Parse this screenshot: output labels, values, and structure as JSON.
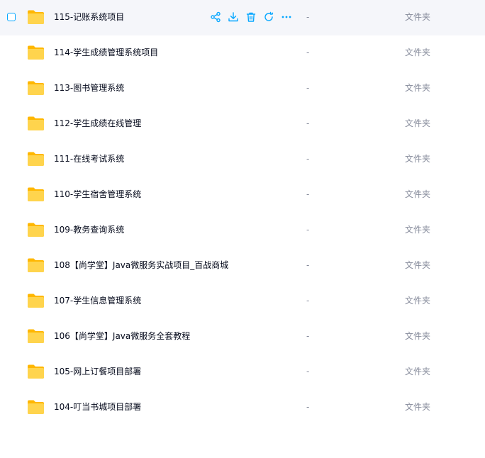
{
  "files": [
    {
      "name": "115-记账系统项目",
      "size": "-",
      "type": "文件夹"
    },
    {
      "name": "114-学生成绩管理系统项目",
      "size": "-",
      "type": "文件夹"
    },
    {
      "name": "113-图书管理系统",
      "size": "-",
      "type": "文件夹"
    },
    {
      "name": "112-学生成绩在线管理",
      "size": "-",
      "type": "文件夹"
    },
    {
      "name": "111-在线考试系统",
      "size": "-",
      "type": "文件夹"
    },
    {
      "name": "110-学生宿舍管理系统",
      "size": "-",
      "type": "文件夹"
    },
    {
      "name": "109-教务查询系统",
      "size": "-",
      "type": "文件夹"
    },
    {
      "name": "108【尚学堂】Java微服务实战项目_百战商城",
      "size": "-",
      "type": "文件夹"
    },
    {
      "name": "107-学生信息管理系统",
      "size": "-",
      "type": "文件夹"
    },
    {
      "name": "106【尚学堂】Java微服务全套教程",
      "size": "-",
      "type": "文件夹"
    },
    {
      "name": "105-网上订餐项目部署",
      "size": "-",
      "type": "文件夹"
    },
    {
      "name": "104-叮当书城项目部署",
      "size": "-",
      "type": "文件夹"
    }
  ],
  "row_actions": [
    "share-icon",
    "download-icon",
    "delete-icon",
    "refresh-icon",
    "more-icon"
  ],
  "colors": {
    "accent": "#06a7ff",
    "folder": "#ffc933",
    "hover_bg": "#f5f6fa",
    "text": "#03081a",
    "muted": "#878c9c"
  }
}
